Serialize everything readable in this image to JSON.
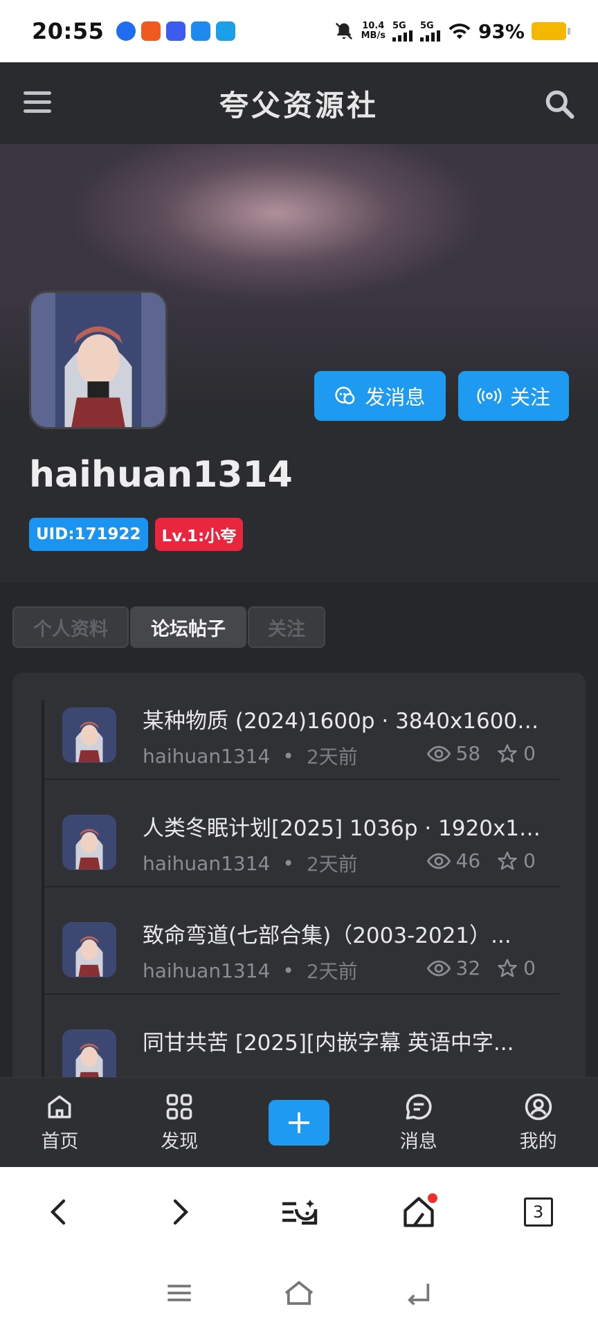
{
  "status_bar": {
    "time": "20:55",
    "speed": "10.4",
    "speed_unit": "MB/s",
    "signal1": "5G",
    "signal2": "5G",
    "battery": "93%",
    "app_icon_colors": [
      "#1e6cf0",
      "#f05a1e",
      "#3c5cf0",
      "#1e8af0",
      "#1aa0e8"
    ]
  },
  "header": {
    "site_title": "夸父资源社"
  },
  "profile": {
    "message_button": "发消息",
    "follow_button": "关注",
    "username": "haihuan1314",
    "uid_badge": "UID:171922",
    "level_badge": "Lv.1:小夸"
  },
  "tabs": [
    {
      "label": "个人资料",
      "active": false
    },
    {
      "label": "论坛帖子",
      "active": true
    },
    {
      "label": "关注",
      "active": false
    }
  ],
  "posts": [
    {
      "title": "某种物质 (2024)1600p · 3840x1600 ...",
      "author": "haihuan1314",
      "time": "2天前",
      "views": "58",
      "favorites": "0"
    },
    {
      "title": "人类冬眠计划[2025] 1036p · 1920x1036 ...",
      "author": "haihuan1314",
      "time": "2天前",
      "views": "46",
      "favorites": "0"
    },
    {
      "title": "致命弯道(七部合集)（2003-2021）...",
      "author": "haihuan1314",
      "time": "2天前",
      "views": "32",
      "favorites": "0"
    },
    {
      "title": "同甘共苦 [2025][内嵌字幕 英语中字...",
      "author": "haihuan1314",
      "time": "2天前",
      "views": "",
      "favorites": ""
    }
  ],
  "bottom_nav": {
    "home": "首页",
    "discover": "发现",
    "messages": "消息",
    "mine": "我的"
  },
  "browser_bar": {
    "tab_count": "3"
  },
  "colors": {
    "accent": "#1e9bf0",
    "level_badge": "#e8273f",
    "dark_bg": "#2b2c30"
  }
}
